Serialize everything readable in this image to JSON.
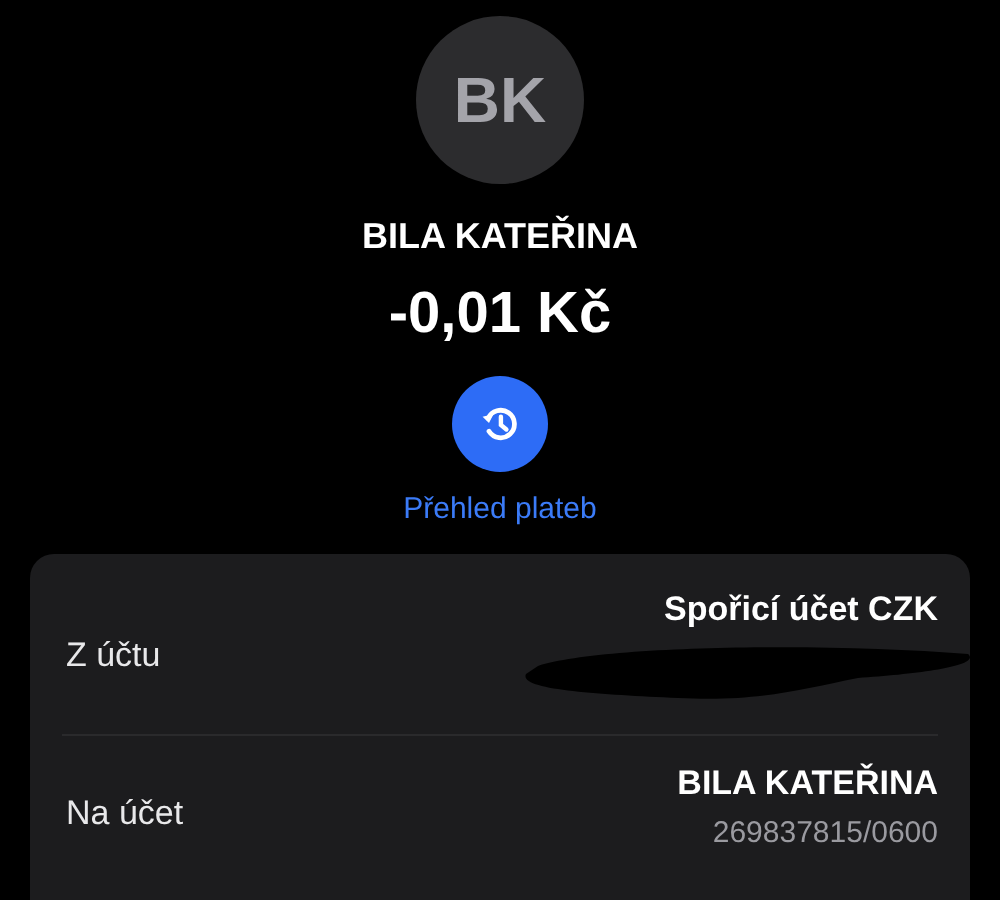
{
  "contact": {
    "initials": "BK",
    "name": "BILA KATEŘINA"
  },
  "amount": "-0,01 Kč",
  "history_link": "Přehled plateb",
  "details": [
    {
      "label": "Z účtu",
      "value": "Spořicí účet CZK",
      "redacted": true
    },
    {
      "label": "Na účet",
      "value": "BILA KATEŘINA",
      "sub": "269837815/0600",
      "redacted": false
    }
  ]
}
